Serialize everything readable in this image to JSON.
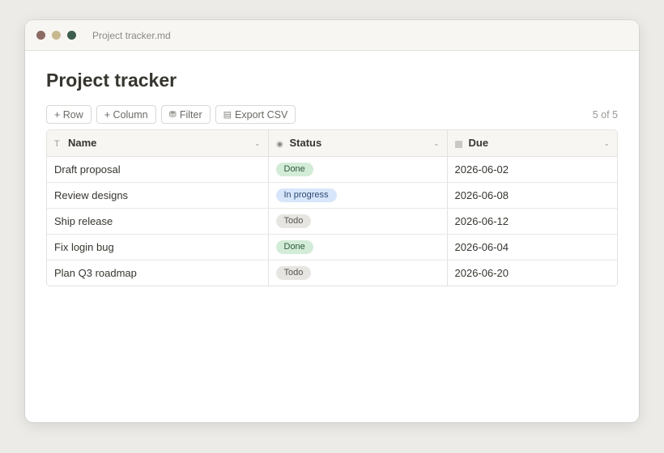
{
  "window": {
    "title": "Project tracker.md"
  },
  "page": {
    "title": "Project tracker"
  },
  "toolbar": {
    "add_row": "+ Row",
    "add_column": "+ Column",
    "filter": "Filter",
    "export": "Export CSV",
    "count": "5 of 5"
  },
  "table": {
    "columns": [
      {
        "label": "Name",
        "icon": "text-type-icon",
        "icon_glyph": "T"
      },
      {
        "label": "Status",
        "icon": "status-icon"
      },
      {
        "label": "Due",
        "icon": "calendar-icon"
      }
    ],
    "rows": [
      {
        "name": "Draft proposal",
        "status": "Done",
        "due": "2026-06-02"
      },
      {
        "name": "Review designs",
        "status": "In progress",
        "due": "2026-06-08"
      },
      {
        "name": "Ship release",
        "status": "Todo",
        "due": "2026-06-12"
      },
      {
        "name": "Fix login bug",
        "status": "Done",
        "due": "2026-06-04"
      },
      {
        "name": "Plan Q3 roadmap",
        "status": "Todo",
        "due": "2026-06-20"
      }
    ]
  },
  "status_colors": {
    "Done": {
      "bg": "#d3ecd8",
      "fg": "#2f5a3a"
    },
    "In progress": {
      "bg": "#d7e6fa",
      "fg": "#2e4a73"
    },
    "Todo": {
      "bg": "#e6e5e1",
      "fg": "#55534e"
    }
  }
}
